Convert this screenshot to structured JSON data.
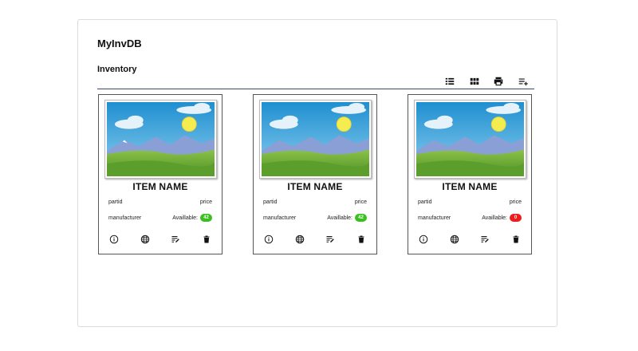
{
  "app": {
    "title": "MyInvDB"
  },
  "inventory": {
    "heading": "Inventory",
    "toolbar": [
      "list-view-icon",
      "grid-view-icon",
      "print-icon",
      "add-item-icon"
    ],
    "cards": [
      {
        "name": "ITEM NAME",
        "partid": "partid",
        "price": "price",
        "manufacturer": "manufacturer",
        "available_label": "Availlable:",
        "available_count": "42",
        "badge_color": "#3bbf1f"
      },
      {
        "name": "ITEM NAME",
        "partid": "partid",
        "price": "price",
        "manufacturer": "manufacturer",
        "available_label": "Availlable:",
        "available_count": "42",
        "badge_color": "#3bbf1f"
      },
      {
        "name": "ITEM NAME",
        "partid": "partid",
        "price": "price",
        "manufacturer": "manufacturer",
        "available_label": "Availlable:",
        "available_count": "0",
        "badge_color": "#ee1c1c"
      }
    ],
    "card_actions": [
      "info-icon",
      "globe-icon",
      "edit-note-icon",
      "delete-icon"
    ]
  }
}
